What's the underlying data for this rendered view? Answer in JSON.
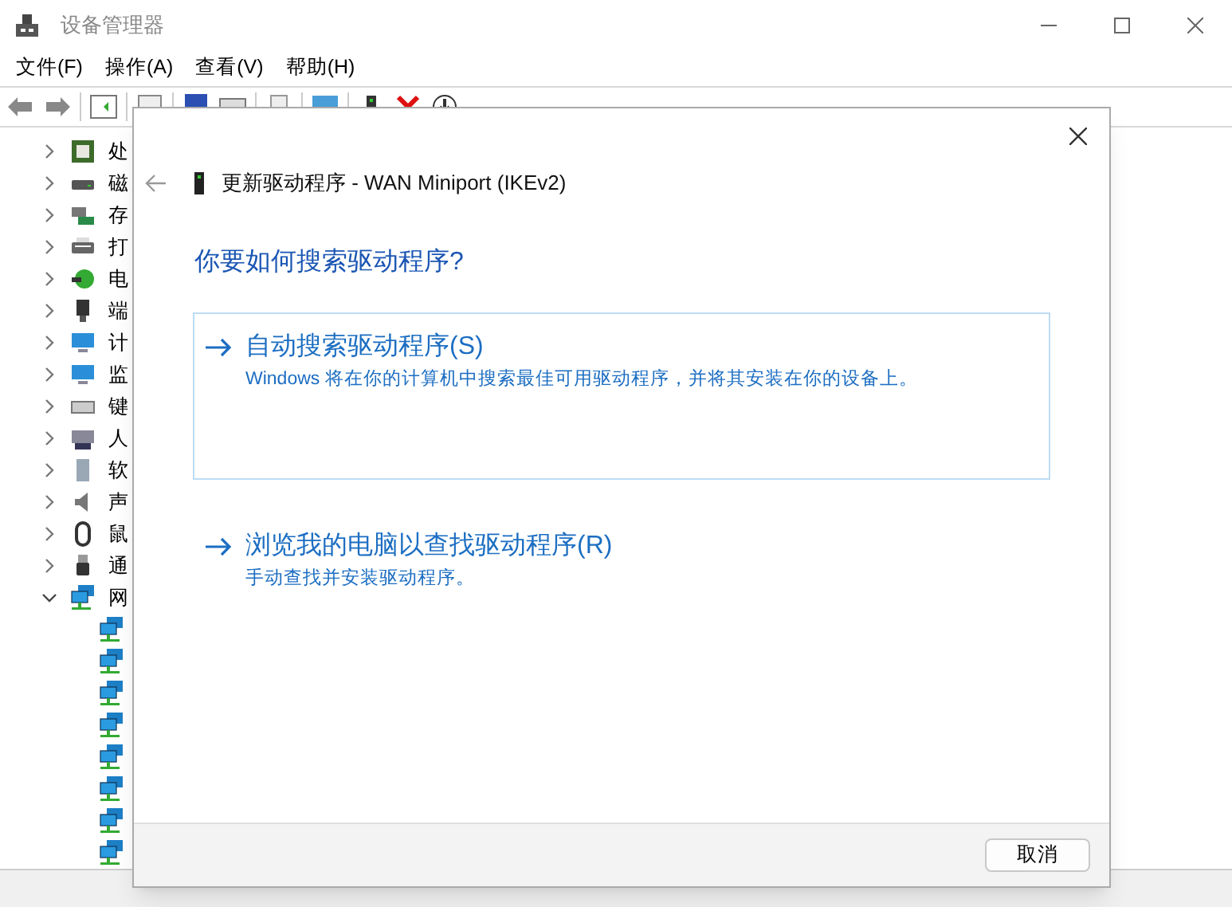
{
  "window": {
    "title": "设备管理器"
  },
  "menu": [
    "文件(F)",
    "操作(A)",
    "查看(V)",
    "帮助(H)"
  ],
  "tree": [
    {
      "label": "处",
      "expanded": false,
      "kind": "processor"
    },
    {
      "label": "磁",
      "expanded": false,
      "kind": "disk"
    },
    {
      "label": "存",
      "expanded": false,
      "kind": "storage"
    },
    {
      "label": "打",
      "expanded": false,
      "kind": "printer"
    },
    {
      "label": "电",
      "expanded": false,
      "kind": "battery"
    },
    {
      "label": "端",
      "expanded": false,
      "kind": "port"
    },
    {
      "label": "计",
      "expanded": false,
      "kind": "monitor"
    },
    {
      "label": "监",
      "expanded": false,
      "kind": "monitor"
    },
    {
      "label": "键",
      "expanded": false,
      "kind": "keyboard"
    },
    {
      "label": "人",
      "expanded": false,
      "kind": "hid"
    },
    {
      "label": "软",
      "expanded": false,
      "kind": "software"
    },
    {
      "label": "声",
      "expanded": false,
      "kind": "sound"
    },
    {
      "label": "鼠",
      "expanded": false,
      "kind": "mouse"
    },
    {
      "label": "通",
      "expanded": false,
      "kind": "usb"
    },
    {
      "label": "网",
      "expanded": true,
      "kind": "network",
      "children": [
        {
          "kind": "network"
        },
        {
          "kind": "network"
        },
        {
          "kind": "network"
        },
        {
          "kind": "network"
        },
        {
          "kind": "network"
        },
        {
          "kind": "network"
        },
        {
          "kind": "network"
        },
        {
          "kind": "network"
        }
      ]
    }
  ],
  "dialog": {
    "title": "更新驱动程序 - WAN Miniport (IKEv2)",
    "question": "你要如何搜索驱动程序?",
    "options": [
      {
        "title": "自动搜索驱动程序(S)",
        "description": "Windows 将在你的计算机中搜索最佳可用驱动程序，并将其安装在你的设备上。",
        "selected": true
      },
      {
        "title": "浏览我的电脑以查找驱动程序(R)",
        "description": "手动查找并安装驱动程序。",
        "selected": false
      }
    ],
    "cancel": "取消"
  }
}
